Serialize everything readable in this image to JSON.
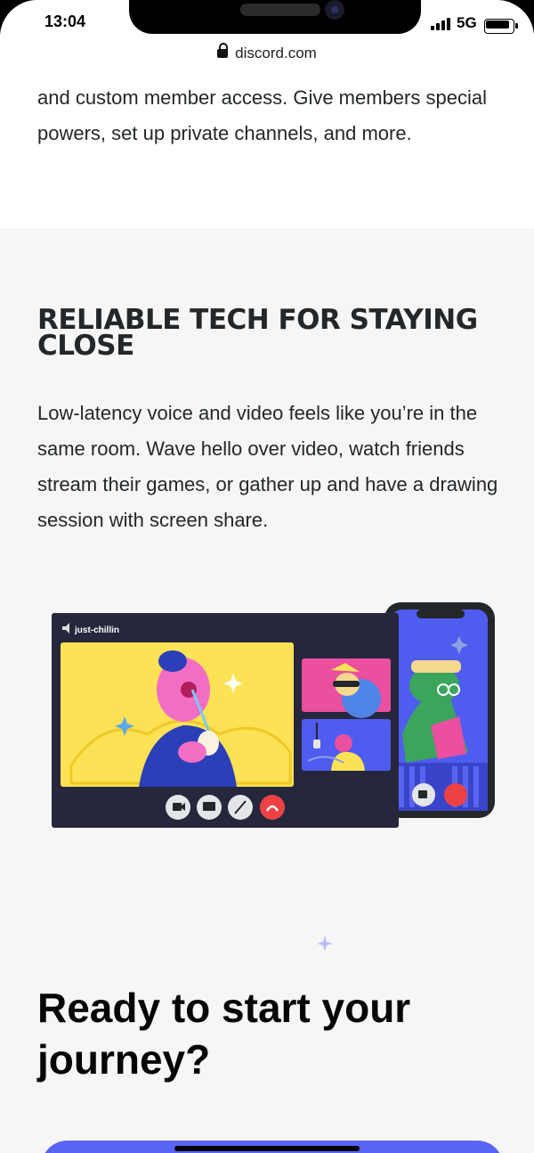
{
  "status": {
    "time": "13:04",
    "network": "5G"
  },
  "browser": {
    "url": "discord.com"
  },
  "intro_text": "and custom member access. Give members special powers, set up private channels, and more.",
  "section": {
    "heading": "RELIABLE TECH FOR STAYING CLOSE",
    "body": "Low-latency voice and video feels like you’re in the same room. Wave hello over video, watch friends stream their games, or gather up and have a drawing session with screen share."
  },
  "illustration": {
    "channel_name": "just-chillin",
    "colors": {
      "panel": "#26273d",
      "main_tile": "#fde255",
      "pink_tile": "#eb4fa0",
      "blue_tile": "#4f5cf0",
      "end_call": "#ed4245"
    }
  },
  "cta": {
    "title": "Ready to start your journey?"
  },
  "colors": {
    "brand": "#5865f2",
    "background": "#f6f6f6",
    "text": "#23272a"
  }
}
